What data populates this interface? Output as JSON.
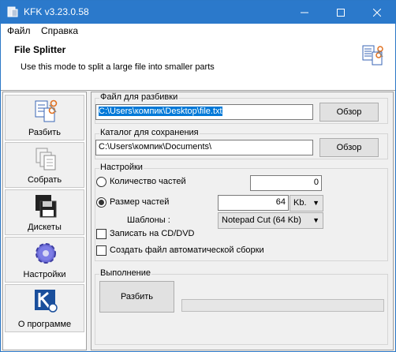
{
  "window": {
    "title": "KFK v3.23.0.58"
  },
  "menu": {
    "file": "Файл",
    "help": "Справка"
  },
  "header": {
    "title": "File Splitter",
    "subtitle": "Use this mode to split a large file into smaller parts"
  },
  "sidebar": {
    "items": [
      {
        "label": "Разбить"
      },
      {
        "label": "Собрать"
      },
      {
        "label": "Дискеты"
      },
      {
        "label": "Настройки"
      },
      {
        "label": "О программе"
      }
    ]
  },
  "file_group": {
    "title": "Файл для разбивки",
    "value": "C:\\Users\\компик\\Desktop\\file.txt",
    "browse": "Обзор"
  },
  "dir_group": {
    "title": "Каталог для сохранения",
    "value": "C:\\Users\\компик\\Documents\\",
    "browse": "Обзор"
  },
  "settings": {
    "title": "Настройки",
    "count_label": "Количество частей",
    "count_value": "0",
    "size_label": "Размер частей",
    "size_value": "64",
    "size_unit": "Kb.",
    "templates_label": "Шаблоны :",
    "template_value": "Notepad Cut (64 Kb)",
    "cd_label": "Записать на CD/DVD",
    "auto_label": "Создать файл автоматической сборки",
    "mode": "size",
    "cd_checked": false,
    "auto_checked": false
  },
  "exec": {
    "title": "Выполнение",
    "button": "Разбить",
    "progress": 0
  },
  "colors": {
    "titlebar": "#2b79cb",
    "selection": "#0078d7"
  }
}
